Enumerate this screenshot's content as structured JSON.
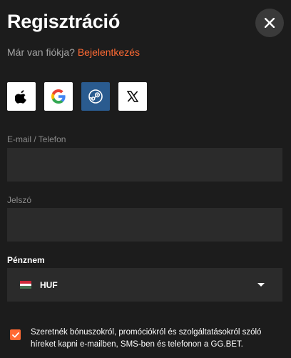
{
  "header": {
    "title": "Regisztráció",
    "close_icon": "close-icon"
  },
  "login_prompt": {
    "text": "Már van fiókja?",
    "link_label": "Bejelentkezés"
  },
  "social": {
    "buttons": [
      {
        "name": "apple",
        "icon": "apple-icon"
      },
      {
        "name": "google",
        "icon": "google-icon"
      },
      {
        "name": "steam",
        "icon": "steam-icon"
      },
      {
        "name": "x",
        "icon": "x-icon"
      }
    ]
  },
  "form": {
    "email_label": "E-mail / Telefon",
    "email_value": "",
    "password_label": "Jelszó",
    "password_value": "",
    "currency_label": "Pénznem",
    "currency_value": "HUF",
    "currency_flag": "hungary-flag-icon"
  },
  "consent": {
    "checked": true,
    "text": "Szeretnék bónuszokról, promóciókról és szolgáltatásokról szóló híreket kapni e-mailben, SMS-ben és telefonon a GG.BET."
  },
  "colors": {
    "background": "#1c1c1c",
    "field": "#2b2b2b",
    "accent": "#ff6a33",
    "steam": "#2a5b8f"
  }
}
